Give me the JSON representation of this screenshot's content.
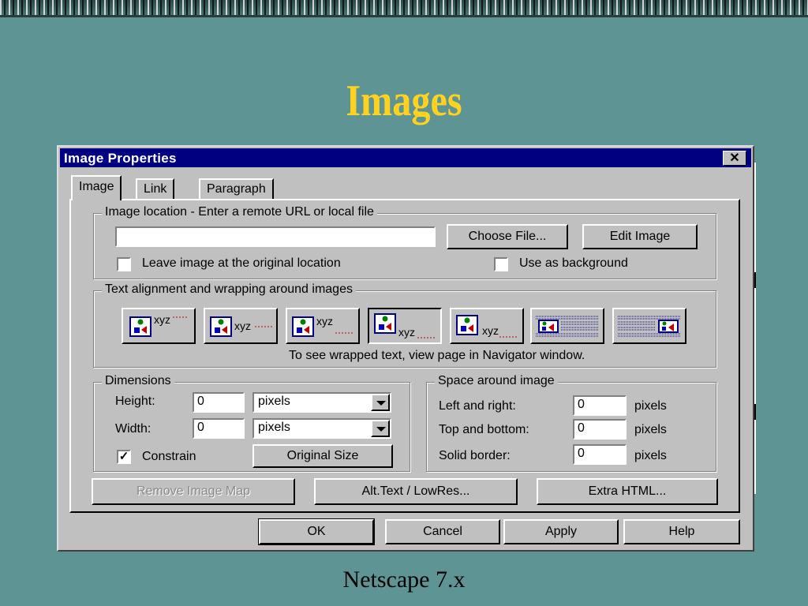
{
  "slide": {
    "title": "Images",
    "caption": "Netscape 7.x"
  },
  "dialog": {
    "title": "Image Properties",
    "close_glyph": "✕",
    "tabs": [
      {
        "label": "Image",
        "active": true
      },
      {
        "label": "Link",
        "active": false
      },
      {
        "label": "Paragraph",
        "active": false
      }
    ],
    "location": {
      "group_label": "Image location - Enter a remote URL or local file",
      "url_value": "",
      "choose_file_label": "Choose File...",
      "edit_image_label": "Edit Image",
      "leave_original_label": "Leave image at the original location",
      "leave_original_checked": false,
      "use_background_label": "Use as background",
      "use_background_checked": false
    },
    "alignment": {
      "group_label": "Text alignment and wrapping around images",
      "sample_text": "xyz",
      "options": [
        "top",
        "middle",
        "bottom",
        "baseline",
        "absbottom",
        "wrap-left",
        "wrap-right"
      ],
      "selected_index": 3,
      "note": "To see wrapped text, view page in Navigator window."
    },
    "dimensions": {
      "group_label": "Dimensions",
      "height_label": "Height:",
      "height_value": "0",
      "height_unit": "pixels",
      "width_label": "Width:",
      "width_value": "0",
      "width_unit": "pixels",
      "constrain_label": "Constrain",
      "constrain_checked": true,
      "original_size_label": "Original Size"
    },
    "space": {
      "group_label": "Space around image",
      "left_right_label": "Left and right:",
      "left_right_value": "0",
      "top_bottom_label": "Top and bottom:",
      "top_bottom_value": "0",
      "border_label": "Solid border:",
      "border_value": "0",
      "unit": "pixels"
    },
    "actions": {
      "remove_map_label": "Remove Image Map",
      "alt_text_label": "Alt.Text / LowRes...",
      "extra_html_label": "Extra HTML..."
    },
    "footer": {
      "ok_label": "OK",
      "cancel_label": "Cancel",
      "apply_label": "Apply",
      "help_label": "Help"
    }
  },
  "colors": {
    "background": "#5f9494",
    "title": "#ffd21f",
    "titlebar": "#000080",
    "dialog_face": "#c0c0c0"
  }
}
